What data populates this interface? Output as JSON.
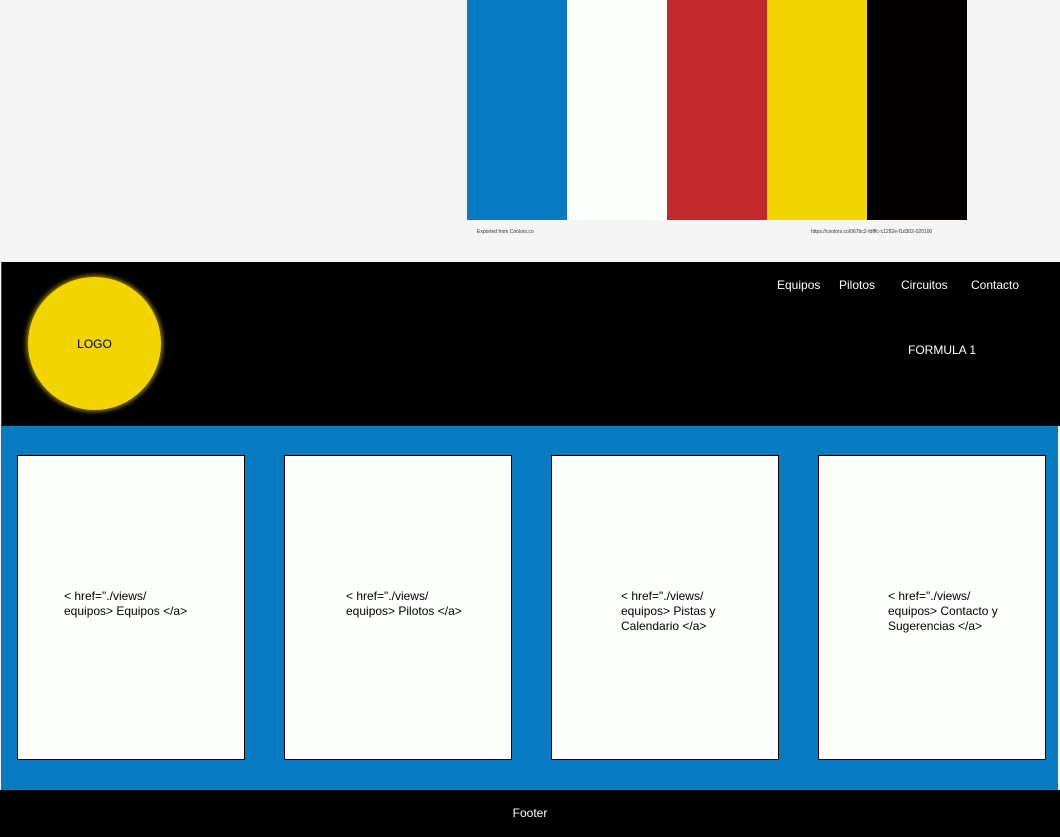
{
  "colors": {
    "blue": "#077bc2",
    "white": "#fdfffc",
    "red": "#c1292e",
    "yellow": "#f2d400",
    "black": "#000000",
    "page_bg": "#f5f5f5"
  },
  "palette": {
    "swatches": [
      "#077bc2",
      "#fdfffc",
      "#c1292e",
      "#f2d400",
      "#020100"
    ],
    "caption_left": "Exported from Coolors.co",
    "caption_right": "https://coolors.co/067bc2-fdfffc-c1292e-f1d302-020100"
  },
  "header": {
    "logo_label": "LOGO",
    "nav": [
      {
        "label": "Equipos"
      },
      {
        "label": "Pilotos"
      },
      {
        "label": "Circuitos"
      },
      {
        "label": "Contacto"
      }
    ],
    "brand_title": "FORMULA 1"
  },
  "cards": [
    {
      "text": "< href=\"./views/\nequipos> Equipos </a>"
    },
    {
      "text": "< href=\"./views/\nequipos> Pilotos </a>"
    },
    {
      "text": "< href=\"./views/\nequipos> Pistas y\nCalendario </a>"
    },
    {
      "text": "< href=\"./views/\nequipos> Contacto y\nSugerencias </a>"
    }
  ],
  "footer": {
    "label": "Footer"
  }
}
